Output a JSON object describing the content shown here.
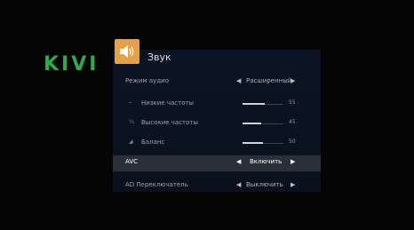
{
  "brand": "KIVI",
  "menu": {
    "title": "Звук",
    "icon": "speaker-icon",
    "accent": "#e2a14a",
    "rows": [
      {
        "label": "Режим аудио",
        "type": "select",
        "value": "Расширенный"
      },
      {
        "label": "Низкие частоты",
        "type": "slider",
        "value": "55",
        "level": 55,
        "icon": "bass-icon"
      },
      {
        "label": "Высокие частоты",
        "type": "slider",
        "value": "45",
        "level": 45,
        "icon": "treble-icon"
      },
      {
        "label": "Баланс",
        "type": "slider",
        "value": "50",
        "level": 50,
        "icon": "balance-icon"
      },
      {
        "label": "AVC",
        "type": "select",
        "value": "Включить",
        "selected": true
      },
      {
        "label": "AD Переключатель",
        "type": "select",
        "value": "Выключить"
      }
    ]
  },
  "colors": {
    "brand": "#2fa84f",
    "background": "#050505",
    "panel": "#0b1320",
    "selected_row": "#2a2f3a"
  }
}
